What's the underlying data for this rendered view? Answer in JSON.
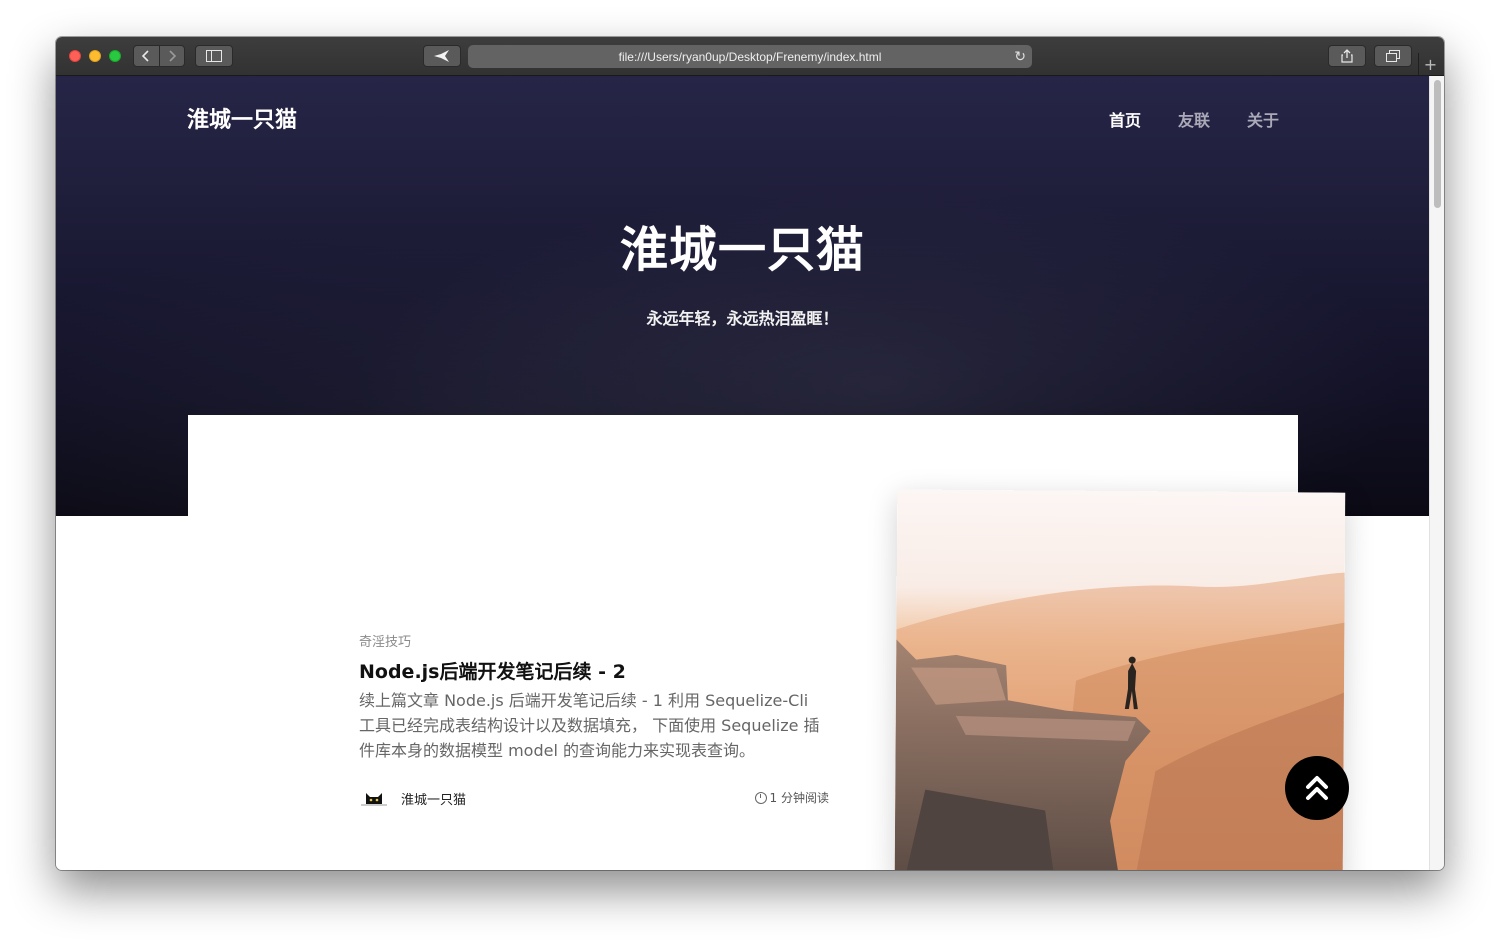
{
  "browser": {
    "url": "file:///Users/ryan0up/Desktop/Frenemy/index.html"
  },
  "site": {
    "brand": "淮城一只猫",
    "nav": [
      {
        "label": "首页",
        "active": true
      },
      {
        "label": "友联",
        "active": false
      },
      {
        "label": "关于",
        "active": false
      }
    ],
    "hero_title": "淮城一只猫",
    "hero_subtitle": "永远年轻，永远热泪盈眶！"
  },
  "post": {
    "tag": "奇淫技巧",
    "title": "Node.js后端开发笔记后续 - 2",
    "excerpt": "续上篇文章 Node.js 后端开发笔记后续 - 1 利用 Sequelize-Cli 工具已经完成表结构设计以及数据填充， 下面使用 Sequelize 插件库本身的数据模型 model 的查询能力来实现表查询。",
    "author": "淮城一只猫",
    "read_time": "1 分钟阅读"
  },
  "colors": {
    "hero_top": "#262547",
    "hero_bottom": "#0b0a14",
    "accent": "#000000"
  }
}
